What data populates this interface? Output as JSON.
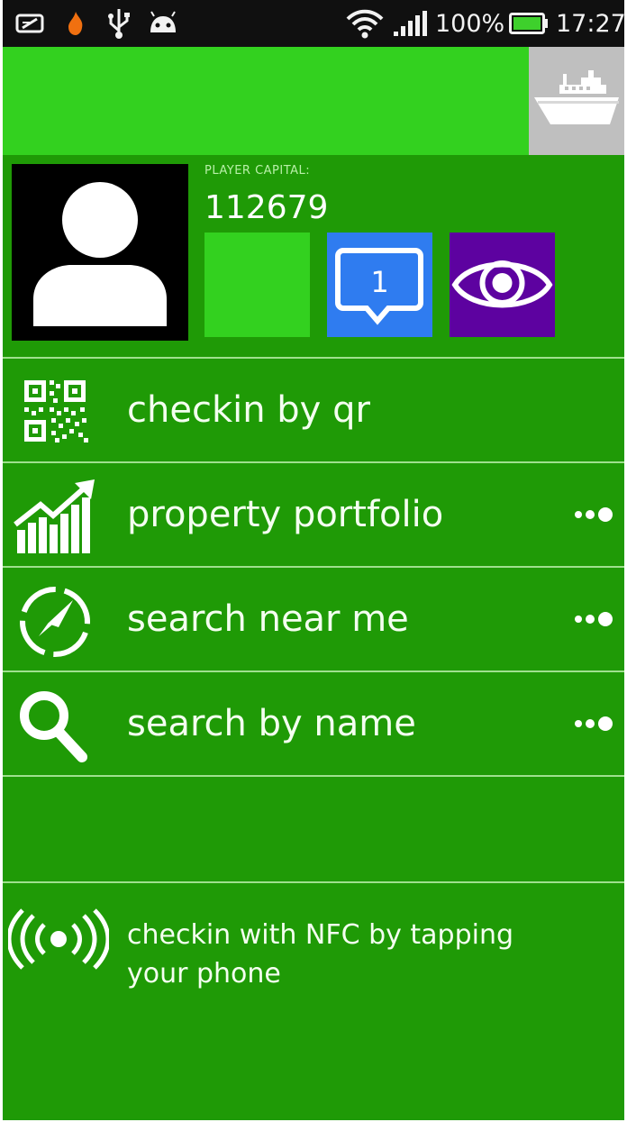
{
  "status_bar": {
    "battery_percent": "100%",
    "time": "17:27",
    "icons": [
      "notification-icon",
      "flame-icon",
      "usb-icon",
      "android-icon",
      "wifi-icon",
      "signal-icon",
      "battery-icon"
    ]
  },
  "header": {
    "icon": "ship-icon",
    "accent_color": "#33d11f"
  },
  "profile": {
    "capital_label": "PLAYER CAPITAL:",
    "capital_value": "112679",
    "messages_count": "1",
    "tile_colors": {
      "green": "#33d11f",
      "blue": "#2f7cf0",
      "purple": "#5d02a0"
    }
  },
  "menu": {
    "items": [
      {
        "label": "checkin by qr",
        "icon": "qr-code-icon",
        "has_more": false
      },
      {
        "label": "property portfolio",
        "icon": "growth-chart-icon",
        "has_more": true
      },
      {
        "label": "search near me",
        "icon": "compass-icon",
        "has_more": true
      },
      {
        "label": "search by name",
        "icon": "search-icon",
        "has_more": true
      }
    ]
  },
  "nfc": {
    "line1": "checkin with NFC by tapping",
    "line2": "your phone",
    "icon": "nfc-icon"
  },
  "colors": {
    "background": "#1f9a06",
    "divider": "#9fe08e"
  }
}
